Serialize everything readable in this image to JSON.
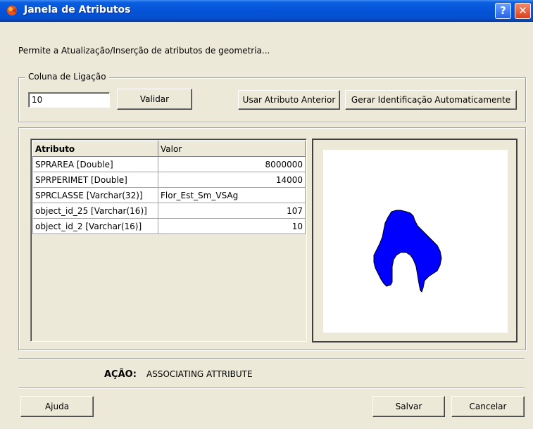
{
  "window": {
    "title": "Janela de Atributos",
    "help_label": "?",
    "close_label": "✕"
  },
  "description": "Permite a Atualização/Inserção de atributos de geometria...",
  "link_group": {
    "label": "Coluna de Ligação",
    "input_value": "10",
    "validate_label": "Validar",
    "use_previous_label": "Usar Atributo Anterior",
    "auto_id_label": "Gerar Identificação Automaticamente"
  },
  "grid": {
    "headers": [
      "Atributo",
      "Valor"
    ],
    "rows": [
      {
        "attr": "SPRAREA [Double]",
        "value": "8000000",
        "numeric": true
      },
      {
        "attr": "SPRPERIMET [Double]",
        "value": "14000",
        "numeric": true
      },
      {
        "attr": "SPRCLASSE [Varchar(32)]",
        "value": "Flor_Est_Sm_VSAg",
        "numeric": false
      },
      {
        "attr": "object_id_25 [Varchar(16)]",
        "value": "107",
        "numeric": true
      },
      {
        "attr": "object_id_2 [Varchar(16)]",
        "value": "10",
        "numeric": true
      }
    ]
  },
  "preview": {
    "shape_color": "#0000ff"
  },
  "status": {
    "label": "AÇÃO:",
    "value": "ASSOCIATING ATTRIBUTE"
  },
  "footer": {
    "help_label": "Ajuda",
    "save_label": "Salvar",
    "cancel_label": "Cancelar"
  }
}
